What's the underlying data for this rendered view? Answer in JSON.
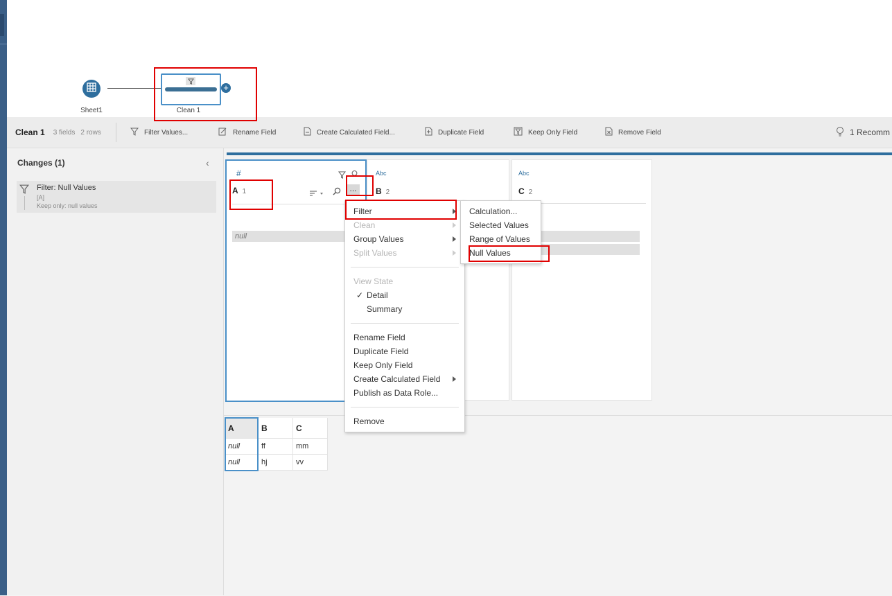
{
  "flow": {
    "input_node": {
      "label": "Sheet1",
      "icon": "table-icon"
    },
    "clean_node": {
      "label": "Clean 1",
      "icon": "filter-icon"
    },
    "add_icon": "plus-circle-icon"
  },
  "toolbar": {
    "step_name": "Clean 1",
    "fields": "3 fields",
    "rows": "2 rows",
    "actions": [
      {
        "label": "Filter Values...",
        "icon": "filter-icon"
      },
      {
        "label": "Rename Field",
        "icon": "rename-icon"
      },
      {
        "label": "Create Calculated Field...",
        "icon": "calc-icon"
      },
      {
        "label": "Duplicate Field",
        "icon": "duplicate-icon"
      },
      {
        "label": "Keep Only Field",
        "icon": "keep-only-icon"
      },
      {
        "label": "Remove Field",
        "icon": "remove-icon"
      }
    ],
    "recommendations": "1 Recomm"
  },
  "changes": {
    "title": "Changes (1)",
    "items": [
      {
        "title": "Filter: Null Values",
        "field": "[A]",
        "detail": "Keep only: null values"
      }
    ]
  },
  "profile": {
    "fields": [
      {
        "type": "#",
        "name": "A",
        "count": "1",
        "bars": [
          "null"
        ]
      },
      {
        "type": "Abc",
        "name": "B",
        "count": "2",
        "bars": []
      },
      {
        "type": "Abc",
        "name": "C",
        "count": "2",
        "bars": [
          "",
          ""
        ]
      }
    ],
    "more_button": "..."
  },
  "context_menu": {
    "filter": "Filter",
    "clean": "Clean",
    "group_values": "Group Values",
    "split_values": "Split Values",
    "view_state": "View State",
    "detail": "Detail",
    "summary": "Summary",
    "rename_field": "Rename Field",
    "duplicate_field": "Duplicate Field",
    "keep_only_field": "Keep Only Field",
    "create_calc_field": "Create Calculated Field",
    "publish_data_role": "Publish as Data Role...",
    "remove": "Remove",
    "check_mark": "✓"
  },
  "filter_submenu": {
    "calculation": "Calculation...",
    "selected_values": "Selected Values",
    "range_of_values": "Range of Values",
    "null_values": "Null Values"
  },
  "grid": {
    "headers": [
      "A",
      "B",
      "C"
    ],
    "rows": [
      [
        "null",
        "ff",
        "mm"
      ],
      [
        "null",
        "hj",
        "vv"
      ]
    ]
  },
  "colors": {
    "accent": "#2e6e9e",
    "highlight": "#e00000",
    "rail": "#3b5f87"
  }
}
